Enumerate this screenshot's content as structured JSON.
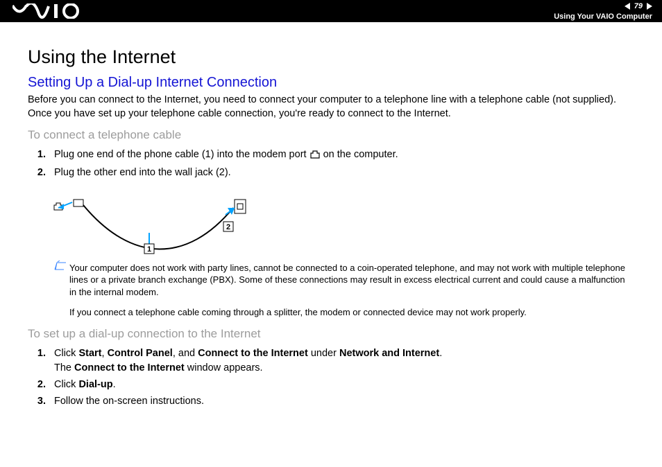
{
  "header": {
    "page_number": "79",
    "section": "Using Your VAIO Computer"
  },
  "content": {
    "h1": "Using the Internet",
    "h2": "Setting Up a Dial-up Internet Connection",
    "intro": "Before you can connect to the Internet, you need to connect your computer to a telephone line with a telephone cable (not supplied). Once you have set up your telephone cable connection, you're ready to connect to the Internet.",
    "h3a": "To connect a telephone cable",
    "stepsA": {
      "s1_pre": "Plug one end of the phone cable (1) into the modem port ",
      "s1_post": " on the computer.",
      "s2": "Plug the other end into the wall jack (2)."
    },
    "figure": {
      "label1": "1",
      "label2": "2"
    },
    "note1": "Your computer does not work with party lines, cannot be connected to a coin-operated telephone, and may not work with multiple telephone lines or a private branch exchange (PBX). Some of these connections may result in excess electrical current and could cause a malfunction in the internal modem.",
    "note2": "If you connect a telephone cable coming through a splitter, the modem or connected device may not work properly.",
    "h3b": "To set up a dial-up connection to the Internet",
    "stepsB": {
      "s1_parts": {
        "t1": "Click ",
        "b1": "Start",
        "t2": ", ",
        "b2": "Control Panel",
        "t3": ", and ",
        "b3": "Connect to the Internet",
        "t4": " under ",
        "b4": "Network and Internet",
        "t5": ".",
        "line2_t1": "The ",
        "line2_b1": "Connect to the Internet",
        "line2_t2": " window appears."
      },
      "s2_parts": {
        "t1": "Click ",
        "b1": "Dial-up",
        "t2": "."
      },
      "s3": "Follow the on-screen instructions."
    }
  }
}
